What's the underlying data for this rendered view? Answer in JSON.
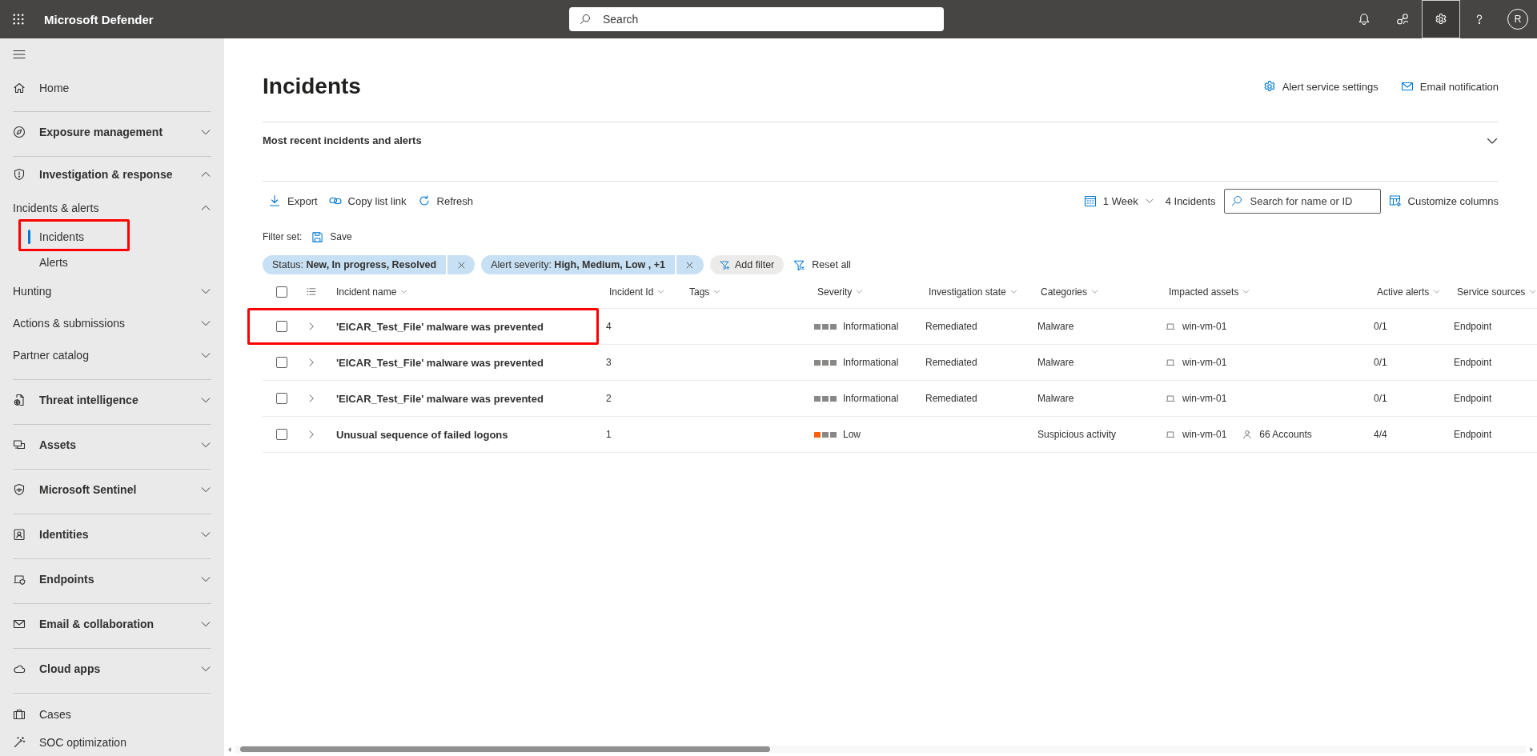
{
  "top_bar": {
    "title": "Microsoft Defender",
    "search": {
      "placeholder": "Search"
    },
    "buttons": [
      {
        "selected": false
      },
      {
        "selected": false
      },
      {
        "selected": true
      },
      {
        "selected": false
      }
    ],
    "avatar": "R"
  },
  "sidebar": {
    "sections": [
      {
        "items": [
          {
            "label": "Home",
            "selected": false
          }
        ]
      },
      {
        "items": [
          {
            "label": "Exposure management",
            "expanded": false
          }
        ]
      },
      {
        "items": [
          {
            "label": "Investigation & response",
            "expanded": true,
            "children": [
              {
                "label": "Incidents & alerts",
                "expanded": true,
                "children": [
                  {
                    "label": "Incidents",
                    "selected": true,
                    "highlighted": true
                  },
                  {
                    "label": "Alerts",
                    "selected": false,
                    "highlighted": false
                  }
                ]
              },
              {
                "label": "Hunting",
                "expanded": false
              },
              {
                "label": "Actions & submissions",
                "expanded": false
              },
              {
                "label": "Partner catalog",
                "expanded": false
              }
            ]
          }
        ]
      },
      {
        "items": [
          {
            "label": "Threat intelligence",
            "expanded": false
          }
        ]
      },
      {
        "items": [
          {
            "label": "Assets",
            "expanded": false
          }
        ]
      },
      {
        "items": [
          {
            "label": "Microsoft Sentinel",
            "expanded": false
          }
        ]
      },
      {
        "items": [
          {
            "label": "Identities",
            "expanded": false
          }
        ]
      },
      {
        "items": [
          {
            "label": "Endpoints",
            "expanded": false
          }
        ]
      },
      {
        "items": [
          {
            "label": "Email & collaboration",
            "expanded": false
          }
        ]
      },
      {
        "items": [
          {
            "label": "Cloud apps",
            "expanded": false
          }
        ]
      },
      {
        "items": [
          {
            "label": "Cases",
            "selected": false
          },
          {
            "label": "SOC optimization",
            "selected": false
          }
        ]
      }
    ]
  },
  "page": {
    "title": "Incidents",
    "actions": [
      {
        "label": "Alert service settings"
      },
      {
        "label": "Email notification"
      }
    ]
  },
  "recent_panel": {
    "title": "Most recent incidents and alerts",
    "expanded": false
  },
  "toolbar": {
    "actions": [
      {
        "label": "Export"
      },
      {
        "label": "Copy list link"
      },
      {
        "label": "Refresh"
      }
    ],
    "period": "1 Week",
    "count": "4 Incidents",
    "search": {
      "placeholder": "Search for name or ID"
    },
    "customize": "Customize columns"
  },
  "filter_set": {
    "label": "Filter set:",
    "save": "Save"
  },
  "filters": {
    "chips": [
      {
        "text": "Status: **New, In progress, Resolved**"
      },
      {
        "text": "Alert severity: **High, Medium, Low , +1**"
      }
    ],
    "add": "Add filter",
    "reset": "Reset all"
  },
  "table": {
    "header_checked": false,
    "columns": [
      {
        "label": "Incident name"
      },
      {
        "label": "Incident Id"
      },
      {
        "label": "Tags"
      },
      {
        "label": "Severity"
      },
      {
        "label": "Investigation state"
      },
      {
        "label": "Categories"
      },
      {
        "label": "Impacted assets"
      },
      {
        "label": "Active alerts"
      },
      {
        "label": "Service sources"
      }
    ],
    "rows": [
      {
        "checked": false,
        "expanded": false,
        "highlighted": true,
        "name": "'EICAR_Test_File' malware was prevented",
        "id": "4",
        "severity": {
          "label": "Informational",
          "kind": "informational"
        },
        "investigation_state": "Remediated",
        "category": "Malware",
        "assets": [
          {
            "kind": "device",
            "label": "win-vm-01"
          }
        ],
        "active_alerts": "0/1",
        "service_sources": "Endpoint"
      },
      {
        "checked": false,
        "expanded": false,
        "highlighted": false,
        "name": "'EICAR_Test_File' malware was prevented",
        "id": "3",
        "severity": {
          "label": "Informational",
          "kind": "informational"
        },
        "investigation_state": "Remediated",
        "category": "Malware",
        "assets": [
          {
            "kind": "device",
            "label": "win-vm-01"
          }
        ],
        "active_alerts": "0/1",
        "service_sources": "Endpoint"
      },
      {
        "checked": false,
        "expanded": false,
        "highlighted": false,
        "name": "'EICAR_Test_File' malware was prevented",
        "id": "2",
        "severity": {
          "label": "Informational",
          "kind": "informational"
        },
        "investigation_state": "Remediated",
        "category": "Malware",
        "assets": [
          {
            "kind": "device",
            "label": "win-vm-01"
          }
        ],
        "active_alerts": "0/1",
        "service_sources": "Endpoint"
      },
      {
        "checked": false,
        "expanded": false,
        "highlighted": false,
        "name": "Unusual sequence of failed logons",
        "id": "1",
        "severity": {
          "label": "Low",
          "kind": "low"
        },
        "category": "Suspicious activity",
        "assets": [
          {
            "kind": "device",
            "label": "win-vm-01"
          },
          {
            "kind": "account",
            "label": "66 Accounts"
          }
        ],
        "active_alerts": "4/4",
        "service_sources": "Endpoint"
      }
    ]
  }
}
